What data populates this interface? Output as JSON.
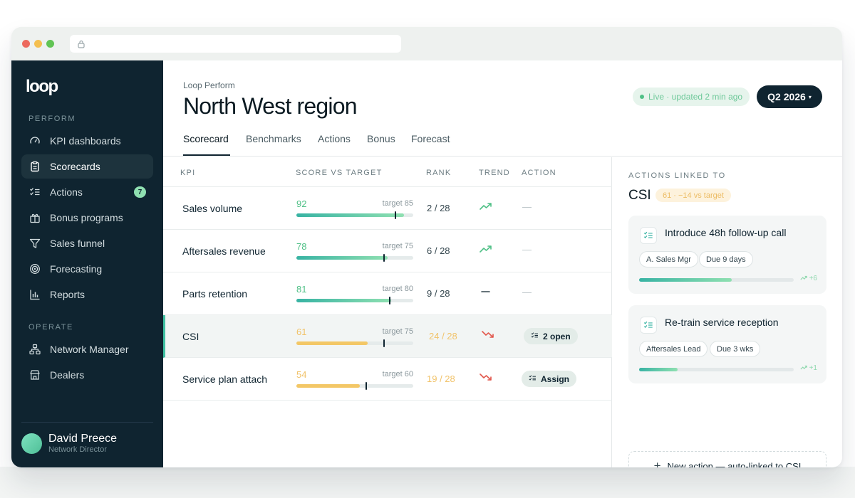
{
  "app": {
    "logo": "loop"
  },
  "sidebar": {
    "sections": [
      "PERFORM",
      "OPERATE"
    ],
    "perform_items": [
      {
        "label": "KPI dashboards",
        "icon": "gauge-icon"
      },
      {
        "label": "Scorecards",
        "icon": "clipboard-icon",
        "active": true
      },
      {
        "label": "Actions",
        "icon": "checklist-icon",
        "badge": "7"
      },
      {
        "label": "Bonus programs",
        "icon": "gift-icon"
      },
      {
        "label": "Sales funnel",
        "icon": "funnel-icon"
      },
      {
        "label": "Forecasting",
        "icon": "target-icon"
      },
      {
        "label": "Reports",
        "icon": "bar-chart-icon"
      }
    ],
    "operate_items": [
      {
        "label": "Network Manager",
        "icon": "network-icon"
      },
      {
        "label": "Dealers",
        "icon": "store-icon"
      }
    ],
    "user": {
      "name": "David Preece",
      "role": "Network Director"
    }
  },
  "header": {
    "eyebrow": "Loop Perform",
    "title": "North West region",
    "live_status": "Live · updated 2 min ago",
    "period": "Q2 2026",
    "period_caret": "▾"
  },
  "tabs": [
    "Scorecard",
    "Benchmarks",
    "Actions",
    "Bonus",
    "Forecast"
  ],
  "table": {
    "headers": [
      "KPI",
      "SCORE VS TARGET",
      "RANK",
      "TREND",
      "ACTION"
    ],
    "rows": [
      {
        "kpi": "Sales volume",
        "score": "92",
        "score_value": 92,
        "target": "target 85",
        "target_value": 85,
        "rank": "2 / 28",
        "trend": "up",
        "action": "—"
      },
      {
        "kpi": "Aftersales revenue",
        "score": "78",
        "score_value": 78,
        "target": "target 75",
        "target_value": 75,
        "rank": "6 / 28",
        "trend": "up",
        "action": "—"
      },
      {
        "kpi": "Parts retention",
        "score": "81",
        "score_value": 81,
        "target": "target 80",
        "target_value": 80,
        "rank": "9 / 28",
        "trend": "flat",
        "action": "—"
      },
      {
        "kpi": "CSI",
        "score": "61",
        "score_value": 61,
        "target": "target 75",
        "target_value": 75,
        "rank": "24 / 28",
        "trend": "down",
        "action": "2 open"
      },
      {
        "kpi": "Service plan attach",
        "score": "54",
        "score_value": 54,
        "target": "target 60",
        "target_value": 60,
        "rank": "19 / 28",
        "trend": "down",
        "action": "Assign"
      }
    ]
  },
  "panel": {
    "eyebrow": "ACTIONS LINKED TO",
    "title": "CSI",
    "pill": "61 · −14 vs target",
    "cards": [
      {
        "title": "Introduce 48h follow-up call",
        "tags": [
          "A. Sales Mgr",
          "Due 9 days"
        ],
        "progress": 0.6,
        "delta": "+6"
      },
      {
        "title": "Re-train service reception",
        "tags": [
          "Aftersales Lead",
          "Due 3 wks"
        ],
        "progress": 0.25,
        "delta": "+1"
      }
    ],
    "new_action": "New action — auto-linked to CSI",
    "new_action_icon": "+"
  },
  "colors": {
    "navy": "#0f2430",
    "green": "#4fc086",
    "amber": "#f1c36a",
    "red": "#e2574c",
    "teal": "#38b3a3"
  }
}
